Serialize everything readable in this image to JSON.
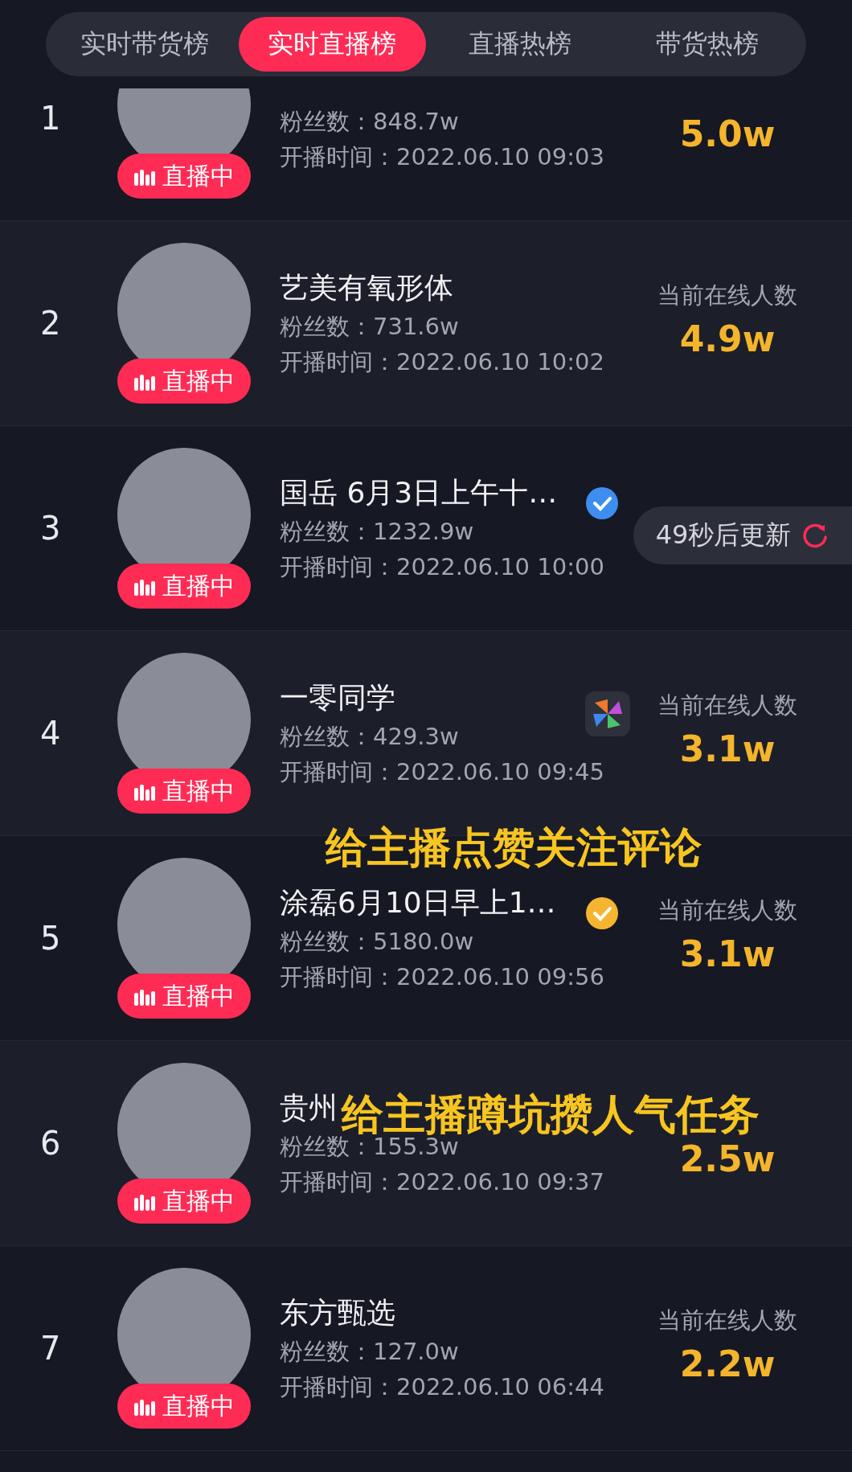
{
  "tabs": [
    {
      "label": "实时带货榜",
      "selected": false
    },
    {
      "label": "实时直播榜",
      "selected": true
    },
    {
      "label": "直播热榜",
      "selected": false
    },
    {
      "label": "带货热榜",
      "selected": false
    }
  ],
  "rows": [
    {
      "kind": "plain",
      "rank": "1",
      "clipped": true,
      "badge_label": "直播中",
      "fans": "粉丝数：848.7w",
      "start": "开播时间：2022.06.10 09:03",
      "value": "5.0w"
    },
    {
      "kind": "plain",
      "rank": "2",
      "name": "艺美有氧形体",
      "badge_label": "直播中",
      "fans": "粉丝数：731.6w",
      "start": "开播时间：2022.06.10 10:02",
      "online_label": "当前在线人数",
      "value": "4.9w"
    },
    {
      "kind": "verified_blue",
      "rank": "3",
      "name": "国岳 6月3日上午十…",
      "badge_label": "直播中",
      "fans": "粉丝数：1232.9w",
      "start": "开播时间：2022.06.10 10:00"
    },
    {
      "kind": "pinwheel",
      "rank": "4",
      "name": "一零同学",
      "badge_label": "直播中",
      "fans": "粉丝数：429.3w",
      "start": "开播时间：2022.06.10 09:45",
      "online_label": "当前在线人数",
      "value": "3.1w"
    },
    {
      "kind": "verified_gold",
      "rank": "5",
      "name": "涂磊6月10日早上1…",
      "badge_label": "直播中",
      "fans": "粉丝数：5180.0w",
      "start": "开播时间：2022.06.10 09:56",
      "online_label": "当前在线人数",
      "value": "3.1w"
    },
    {
      "kind": "plain",
      "rank": "6",
      "name": "贵州",
      "badge_label": "直播中",
      "fans": "粉丝数：155.3w",
      "start": "开播时间：2022.06.10 09:37",
      "value": "2.5w"
    },
    {
      "kind": "plain",
      "rank": "7",
      "name": "东方甄选",
      "badge_label": "直播中",
      "fans": "粉丝数：127.0w",
      "start": "开播时间：2022.06.10 06:44",
      "online_label": "当前在线人数",
      "value": "2.2w"
    }
  ],
  "toast": {
    "text": "49秒后更新"
  },
  "captions": [
    "给主播点赞关注评论",
    "给主播蹲坑攒人气任务"
  ]
}
